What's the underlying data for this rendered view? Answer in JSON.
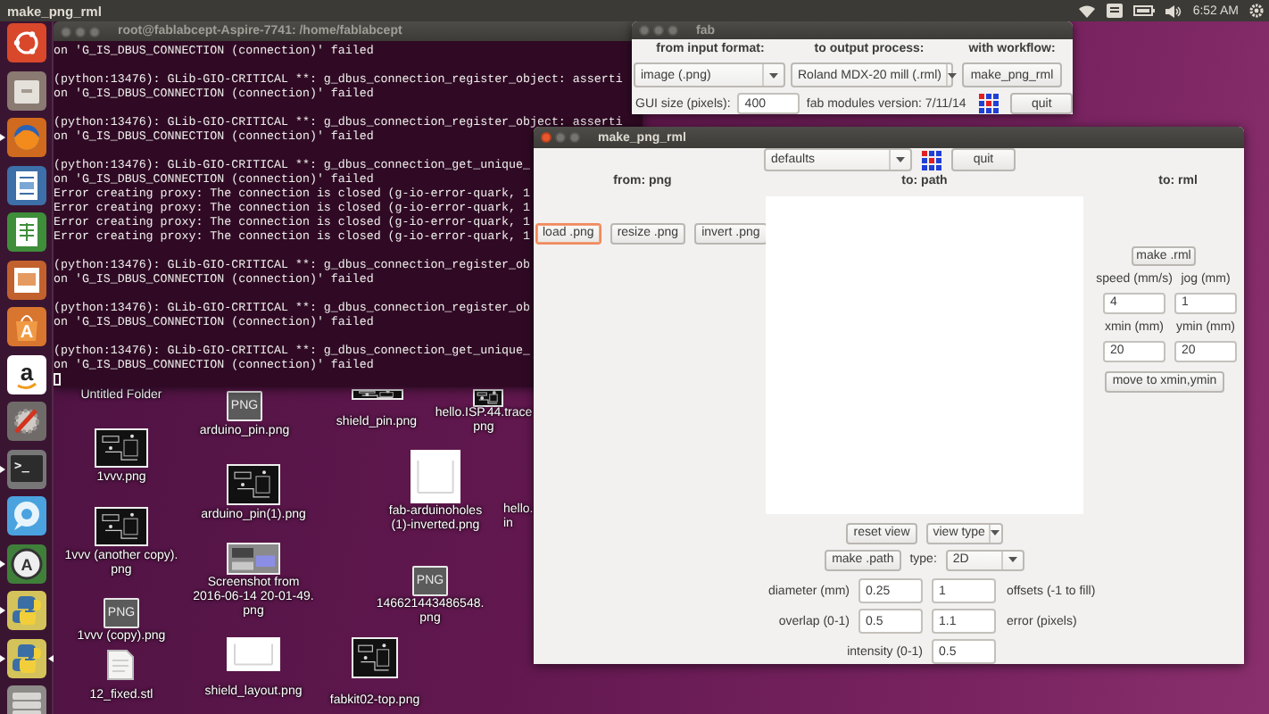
{
  "top_bar": {
    "app_title": "make_png_rml",
    "clock": "6:52 AM"
  },
  "launcher": {
    "items": [
      {
        "kind": "logo",
        "running": false,
        "focused": false
      },
      {
        "kind": "cabinet",
        "running": false,
        "focused": false
      },
      {
        "kind": "browser",
        "running": true,
        "focused": false
      },
      {
        "kind": "textdoc",
        "running": false,
        "focused": false
      },
      {
        "kind": "sheet",
        "running": false,
        "focused": false
      },
      {
        "kind": "slides",
        "running": false,
        "focused": false
      },
      {
        "kind": "bag",
        "glyph": "A",
        "running": false,
        "focused": false
      },
      {
        "kind": "store",
        "glyph": "a",
        "running": false,
        "focused": false
      },
      {
        "kind": "tools",
        "running": false,
        "focused": false
      },
      {
        "kind": "terminal",
        "glyph": ">_",
        "running": true,
        "focused": false
      },
      {
        "kind": "chat",
        "running": false,
        "focused": false
      },
      {
        "kind": "updater",
        "glyph": "A",
        "running": true,
        "focused": false
      },
      {
        "kind": "snake",
        "running": true,
        "focused": false
      },
      {
        "kind": "snake",
        "running": true,
        "focused": true
      },
      {
        "kind": "disks",
        "running": false,
        "focused": false
      }
    ]
  },
  "desktop": {
    "items": [
      {
        "label_lines": [
          "Untitled Folder"
        ]
      },
      {
        "kind": "board",
        "label_lines": [
          "1vvv.png"
        ]
      },
      {
        "kind": "board",
        "label_lines": [
          "1vvv (another copy).",
          "png"
        ]
      },
      {
        "kind": "badge",
        "badge": "PNG",
        "label_lines": [
          "1vvv (copy).png"
        ]
      },
      {
        "kind": "document",
        "label_lines": [
          "12_fixed.stl"
        ]
      },
      {
        "kind": "badge",
        "badge": "PNG",
        "label_lines": [
          "arduino_pin.png"
        ]
      },
      {
        "kind": "board",
        "label_lines": [
          "arduino_pin(1).png"
        ]
      },
      {
        "kind": "screenshot",
        "label_lines": [
          "Screenshot from",
          "2016-06-14 20-01-49.",
          "png"
        ]
      },
      {
        "kind": "blank",
        "label_lines": [
          "shield_layout.png"
        ]
      },
      {
        "kind": "board",
        "label_lines": [
          "shield_pin.png"
        ]
      },
      {
        "kind": "board",
        "label_lines": [
          "fabkit02-top.png"
        ]
      },
      {
        "kind": "blank",
        "label_lines": [
          "fab-arduinoholes",
          "(1)-inverted.png"
        ]
      },
      {
        "kind": "badge",
        "badge": "PNG",
        "label_lines": [
          "146621443486548.",
          "png"
        ]
      },
      {
        "kind": "board",
        "label_lines": [
          "hello.ISP.44.trace",
          "png"
        ]
      },
      {
        "label_lines": [
          "hello.",
          "in"
        ]
      }
    ]
  },
  "terminal": {
    "title": "root@fablabcept-Aspire-7741: /home/fablabcept",
    "active": false,
    "blocks": [
      [
        "on 'G_IS_DBUS_CONNECTION (connection)' failed"
      ],
      [
        "(python:13476): GLib-GIO-CRITICAL **: g_dbus_connection_register_object: asserti",
        "on 'G_IS_DBUS_CONNECTION (connection)' failed"
      ],
      [
        "(python:13476): GLib-GIO-CRITICAL **: g_dbus_connection_register_object: asserti",
        "on 'G_IS_DBUS_CONNECTION (connection)' failed"
      ],
      [
        "(python:13476): GLib-GIO-CRITICAL **: g_dbus_connection_get_unique_",
        "on 'G_IS_DBUS_CONNECTION (connection)' failed",
        "Error creating proxy: The connection is closed (g-io-error-quark, 1",
        "Error creating proxy: The connection is closed (g-io-error-quark, 1",
        "Error creating proxy: The connection is closed (g-io-error-quark, 1",
        "Error creating proxy: The connection is closed (g-io-error-quark, 1"
      ],
      [
        "(python:13476): GLib-GIO-CRITICAL **: g_dbus_connection_register_ob",
        "on 'G_IS_DBUS_CONNECTION (connection)' failed"
      ],
      [
        "(python:13476): GLib-GIO-CRITICAL **: g_dbus_connection_register_ob",
        "on 'G_IS_DBUS_CONNECTION (connection)' failed"
      ],
      [
        "(python:13476): GLib-GIO-CRITICAL **: g_dbus_connection_get_unique_",
        "on 'G_IS_DBUS_CONNECTION (connection)' failed"
      ]
    ]
  },
  "fab_window": {
    "title": "fab",
    "active": false,
    "headers": [
      "from input format:",
      "to output process:",
      "with workflow:"
    ],
    "input_format": "image (.png)",
    "output_process": "Roland MDX-20 mill (.rml)",
    "workflow_button": "make_png_rml",
    "gui_size_label": "GUI size (pixels):",
    "gui_size": "400",
    "version": "fab modules version: 7/11/14",
    "quit": "quit"
  },
  "make_window": {
    "title": "make_png_rml",
    "active": true,
    "preset": "defaults",
    "quit": "quit",
    "headers": [
      "from: png",
      "to: path",
      "to: rml"
    ],
    "png_buttons": [
      {
        "label": "load .png",
        "focused": true
      },
      {
        "label": "resize .png",
        "focused": false
      },
      {
        "label": "invert .png",
        "focused": false
      }
    ],
    "rml": {
      "make_button": "make .rml",
      "speed_label": "speed (mm/s)",
      "jog_label": "jog (mm)",
      "speed": "4",
      "jog": "1",
      "xmin_label": "xmin (mm)",
      "ymin_label": "ymin (mm)",
      "xmin": "20",
      "ymin": "20",
      "move_button": "move to xmin,ymin"
    },
    "reset_button": "reset view",
    "view_type": "view type",
    "path_button": "make .path",
    "type_label": "type:",
    "type": "2D",
    "diameter_label": "diameter (mm)",
    "diameter": "0.25",
    "offsets": "1",
    "offsets_label": "offsets (-1 to fill)",
    "overlap_label": "overlap (0-1)",
    "overlap": "0.5",
    "error": "1.1",
    "error_label": "error (pixels)",
    "intensity_label": "intensity (0-1)",
    "intensity": "0.5"
  }
}
